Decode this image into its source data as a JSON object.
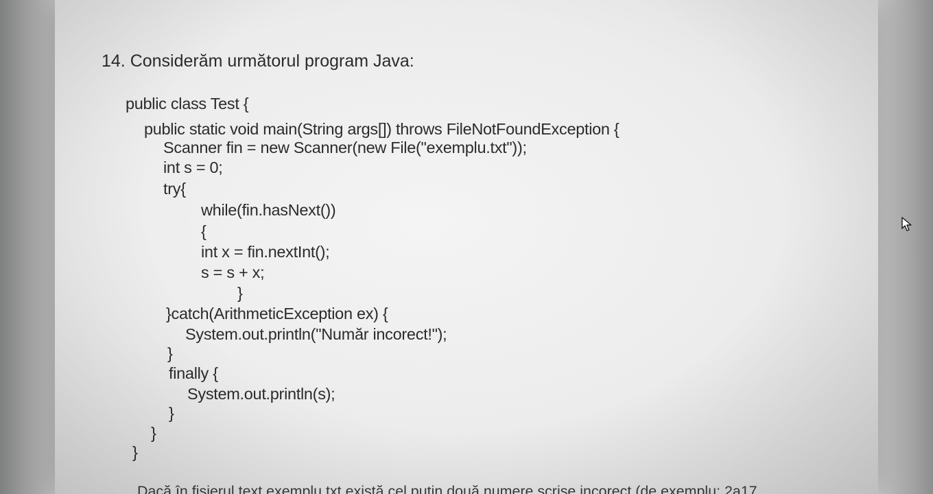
{
  "question": {
    "heading": "14. Considerăm următorul program Java:"
  },
  "code": {
    "lines": [
      "public class Test {",
      "public static void main(String args[]) throws FileNotFoundException {",
      "Scanner fin = new Scanner(new File(\"exemplu.txt\"));",
      "int s = 0;",
      "try{",
      "while(fin.hasNext())",
      "{",
      "int x = fin.nextInt();",
      "s = s + x;",
      "}",
      "}catch(ArithmeticException ex) {",
      "System.out.println(\"Număr incorect!\");",
      "}",
      "finally {",
      "System.out.println(s);",
      "}",
      "}",
      "}"
    ]
  },
  "footer": {
    "text": "Dacă în fișierul text exemplu.txt există cel puțin două numere scrise incorect (de exemplu: 2a17"
  },
  "icons": {
    "cursor": "mouse-pointer-icon"
  }
}
